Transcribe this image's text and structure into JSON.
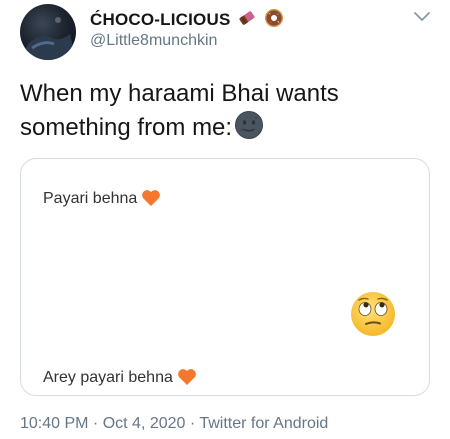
{
  "author": {
    "display_name": "ĆHOCO-LICIOUS",
    "name_emojis": [
      "chocolate-bar-icon",
      "doughnut-icon"
    ],
    "handle": "@Little8munchkin"
  },
  "tweet": {
    "text": "When my haraami Bhai wants something from me:",
    "trailing_emoji": "new-moon-face-icon"
  },
  "media": {
    "line_1": "Payari behna",
    "line_2": "Arey payari behna",
    "heart_emoji": "orange-heart-icon",
    "reaction_emoji": "face-with-rolling-eyes-icon"
  },
  "meta": {
    "text": "10:40 PM · Oct 4, 2020 · Twitter for Android"
  },
  "colors": {
    "text_primary": "#14171a",
    "text_secondary": "#657786",
    "card_border": "#d5dde3",
    "heart": "#f4772b"
  }
}
